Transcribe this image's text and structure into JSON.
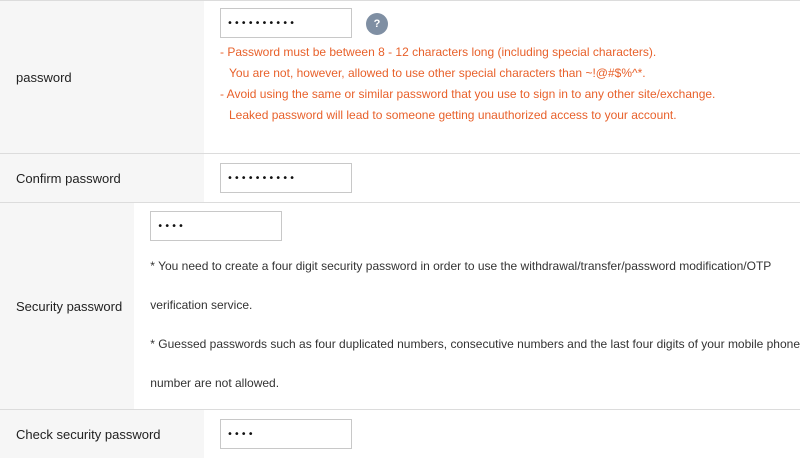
{
  "password": {
    "label": "password",
    "value": "••••••••••",
    "help": "?",
    "rules": [
      "- Password must be between 8 - 12 characters long (including special characters).",
      "  You are not, however, allowed to use other special characters than ~!@#$%^*.",
      "- Avoid using the same or similar password that you use to sign in to any other site/exchange.",
      "  Leaked password will lead to someone getting unauthorized access to your account."
    ]
  },
  "confirm_password": {
    "label": "Confirm password",
    "value": "••••••••••"
  },
  "security_password": {
    "label": "Security password",
    "value": "••••",
    "notes": [
      "* You need to create a four digit security password in order to use the withdrawal/transfer/password modification/OTP",
      "verification service.",
      "* Guessed passwords such as four duplicated numbers, consecutive numbers and the last four digits of your mobile phone",
      "number are not allowed."
    ]
  },
  "check_security_password": {
    "label": "Check security password",
    "value": "••••"
  },
  "colors": {
    "warning": "#e8612b",
    "label_bg": "#f6f6f6",
    "border": "#dcdcdc",
    "help_icon": "#7f8fa3"
  }
}
